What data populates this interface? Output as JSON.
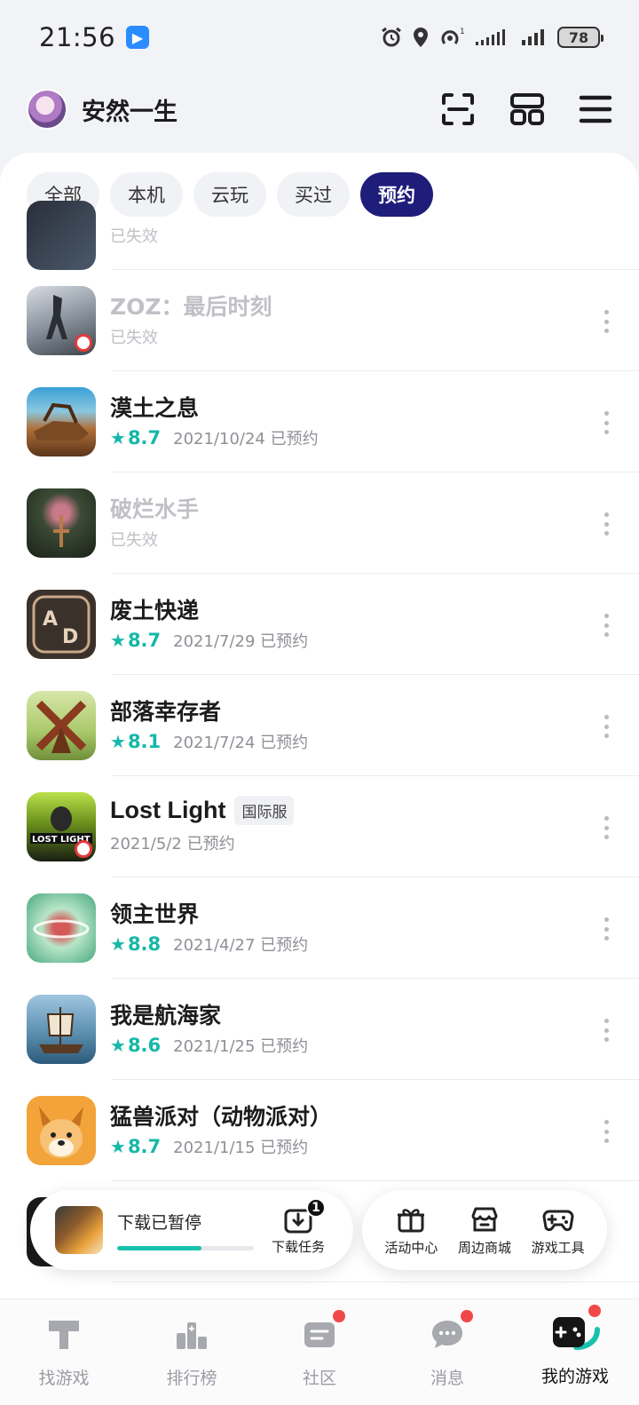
{
  "status_bar": {
    "time": "21:56",
    "app_badge": "▶",
    "battery": "78"
  },
  "header": {
    "username": "安然一生"
  },
  "filters": [
    {
      "label": "全部",
      "active": false
    },
    {
      "label": "本机",
      "active": false
    },
    {
      "label": "云玩",
      "active": false
    },
    {
      "label": "买过",
      "active": false
    },
    {
      "label": "预约",
      "active": true
    }
  ],
  "games": [
    {
      "title": "",
      "status": "已失效",
      "expired": true
    },
    {
      "title": "ZOZ：最后时刻",
      "status": "已失效",
      "expired": true
    },
    {
      "title": "漠土之息",
      "rating": "8.7",
      "date": "2021/10/24 已预约",
      "expired": false
    },
    {
      "title": "破烂水手",
      "status": "已失效",
      "expired": true
    },
    {
      "title": "废土快递",
      "rating": "8.7",
      "date": "2021/7/29 已预约",
      "expired": false
    },
    {
      "title": "部落幸存者",
      "rating": "8.1",
      "date": "2021/7/24 已预约",
      "expired": false
    },
    {
      "title": "Lost Light",
      "tag": "国际服",
      "date": "2021/5/2 已预约",
      "expired": false
    },
    {
      "title": "领主世界",
      "rating": "8.8",
      "date": "2021/4/27 已预约",
      "expired": false
    },
    {
      "title": "我是航海家",
      "rating": "8.6",
      "date": "2021/1/25 已预约",
      "expired": false
    },
    {
      "title": "猛兽派对（动物派对）",
      "rating": "8.7",
      "date": "2021/1/15 已预约",
      "expired": false
    }
  ],
  "download_bar": {
    "status": "下载已暂停",
    "progress": 0.62,
    "task_label": "下载任务",
    "task_count": "1"
  },
  "tools": [
    {
      "label": "活动中心",
      "icon": "gift-icon"
    },
    {
      "label": "周边商城",
      "icon": "shop-icon"
    },
    {
      "label": "游戏工具",
      "icon": "gamepad-icon"
    }
  ],
  "bottom_nav": [
    {
      "label": "找游戏",
      "icon": "discover-icon"
    },
    {
      "label": "排行榜",
      "icon": "ranking-icon"
    },
    {
      "label": "社区",
      "icon": "community-icon",
      "dot": true
    },
    {
      "label": "消息",
      "icon": "message-icon",
      "dot": true
    },
    {
      "label": "我的游戏",
      "icon": "my-games-icon",
      "dot": true,
      "active": true
    }
  ],
  "colors": {
    "accent": "#1f1d7a",
    "rating": "#16b8a8",
    "progress": "#19c1ad",
    "dot": "#f04848"
  }
}
